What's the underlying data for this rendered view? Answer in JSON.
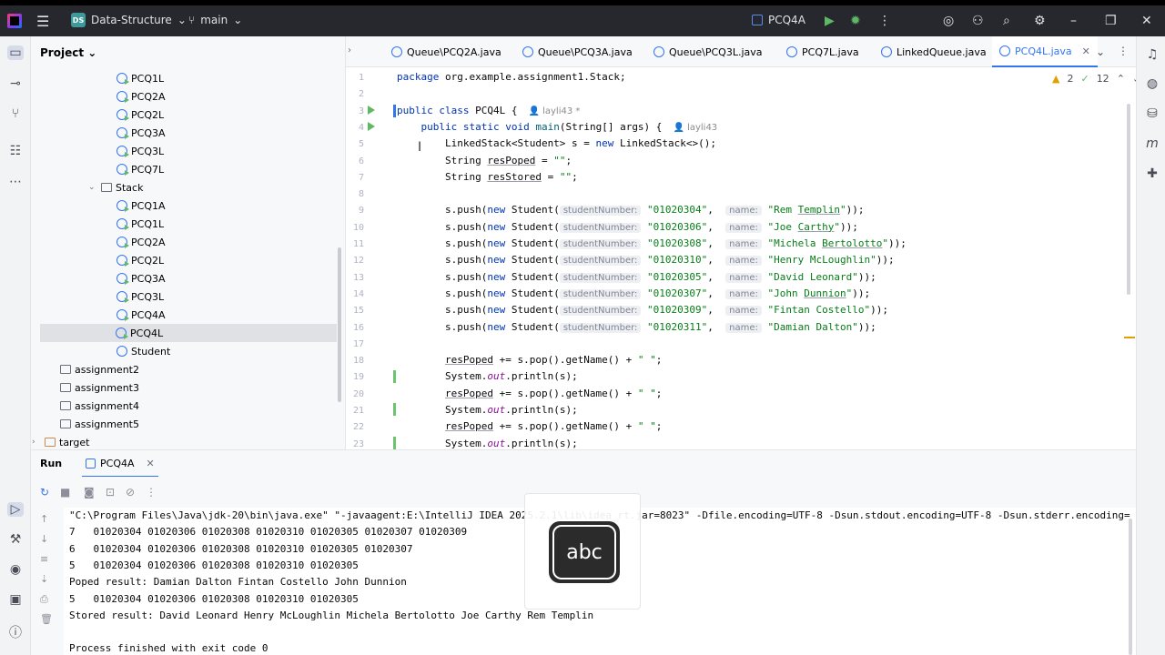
{
  "titlebar": {
    "project_badge": "DS",
    "project_name": "Data-Structure",
    "branch": "main",
    "run_config": "PCQ4A"
  },
  "project_panel": {
    "title": "Project",
    "items": [
      {
        "label": "PCQ1L",
        "type": "class-run",
        "indent": 3
      },
      {
        "label": "PCQ2A",
        "type": "class-run",
        "indent": 3
      },
      {
        "label": "PCQ2L",
        "type": "class-run",
        "indent": 3
      },
      {
        "label": "PCQ3A",
        "type": "class-run",
        "indent": 3
      },
      {
        "label": "PCQ3L",
        "type": "class-run",
        "indent": 3
      },
      {
        "label": "PCQ7L",
        "type": "class-run",
        "indent": 3
      },
      {
        "label": "Stack",
        "type": "package",
        "indent": 2
      },
      {
        "label": "PCQ1A",
        "type": "class-run",
        "indent": 3
      },
      {
        "label": "PCQ1L",
        "type": "class-run",
        "indent": 3
      },
      {
        "label": "PCQ2A",
        "type": "class-run",
        "indent": 3
      },
      {
        "label": "PCQ2L",
        "type": "class-run",
        "indent": 3
      },
      {
        "label": "PCQ3A",
        "type": "class-run",
        "indent": 3
      },
      {
        "label": "PCQ3L",
        "type": "class-run",
        "indent": 3
      },
      {
        "label": "PCQ4A",
        "type": "class-run",
        "indent": 3
      },
      {
        "label": "PCQ4L",
        "type": "class-run",
        "indent": 3,
        "selected": true
      },
      {
        "label": "Student",
        "type": "class",
        "indent": 3
      },
      {
        "label": "assignment2",
        "type": "package",
        "indent": 1
      },
      {
        "label": "assignment3",
        "type": "package",
        "indent": 1
      },
      {
        "label": "assignment4",
        "type": "package",
        "indent": 1
      },
      {
        "label": "assignment5",
        "type": "package",
        "indent": 1
      },
      {
        "label": "target",
        "type": "folder",
        "indent": 0
      }
    ]
  },
  "tabs": [
    {
      "label": "Queue\\PCQ2A.java"
    },
    {
      "label": "Queue\\PCQ3A.java"
    },
    {
      "label": "Queue\\PCQ3L.java"
    },
    {
      "label": "PCQ7L.java"
    },
    {
      "label": "LinkedQueue.java"
    },
    {
      "label": "PCQ4L.java",
      "active": true
    }
  ],
  "editor": {
    "warnings": "2",
    "checks": "12",
    "lines": [
      {
        "n": "1",
        "html": "<span class='kw'>package</span> org.example.assignment1.Stack;"
      },
      {
        "n": "2",
        "html": ""
      },
      {
        "n": "3",
        "html": "<span class='kw'>public class</span> PCQ4L {<span class='author'>👤 layli43 *</span>"
      },
      {
        "n": "4",
        "html": "    <span class='kw'>public static void</span> <span style='color:#00627a'>main</span>(String[] args) {<span class='author'>👤 layli43</span>"
      },
      {
        "n": "5",
        "html": "        LinkedStack&lt;Student&gt; s = <span class='kw'>new</span> LinkedStack&lt;&gt;();"
      },
      {
        "n": "6",
        "html": "        String <span class='underl'>resPoped</span> = <span class='str'>\"\"</span>;"
      },
      {
        "n": "7",
        "html": "        String <span class='underl'>resStored</span> = <span class='str'>\"\"</span>;"
      },
      {
        "n": "8",
        "html": ""
      },
      {
        "n": "9",
        "html": "        s.push(<span class='kw'>new</span> Student(<span class='hint'>studentNumber:</span> <span class='str'>\"01020304\"</span>,  <span class='hint'>name:</span> <span class='str'>\"Rem <span class='underl'>Templin</span>\"</span>));"
      },
      {
        "n": "10",
        "html": "        s.push(<span class='kw'>new</span> Student(<span class='hint'>studentNumber:</span> <span class='str'>\"01020306\"</span>,  <span class='hint'>name:</span> <span class='str'>\"Joe <span class='underl'>Carthy</span>\"</span>));"
      },
      {
        "n": "11",
        "html": "        s.push(<span class='kw'>new</span> Student(<span class='hint'>studentNumber:</span> <span class='str'>\"01020308\"</span>,  <span class='hint'>name:</span> <span class='str'>\"Michela <span class='underl'>Bertolotto</span>\"</span>));"
      },
      {
        "n": "12",
        "html": "        s.push(<span class='kw'>new</span> Student(<span class='hint'>studentNumber:</span> <span class='str'>\"01020310\"</span>,  <span class='hint'>name:</span> <span class='str'>\"Henry McLoughlin\"</span>));"
      },
      {
        "n": "13",
        "html": "        s.push(<span class='kw'>new</span> Student(<span class='hint'>studentNumber:</span> <span class='str'>\"01020305\"</span>,  <span class='hint'>name:</span> <span class='str'>\"David Leonard\"</span>));"
      },
      {
        "n": "14",
        "html": "        s.push(<span class='kw'>new</span> Student(<span class='hint'>studentNumber:</span> <span class='str'>\"01020307\"</span>,  <span class='hint'>name:</span> <span class='str'>\"John <span class='underl'>Dunnion</span>\"</span>));"
      },
      {
        "n": "15",
        "html": "        s.push(<span class='kw'>new</span> Student(<span class='hint'>studentNumber:</span> <span class='str'>\"01020309\"</span>,  <span class='hint'>name:</span> <span class='str'>\"Fintan Costello\"</span>));"
      },
      {
        "n": "16",
        "html": "        s.push(<span class='kw'>new</span> Student(<span class='hint'>studentNumber:</span> <span class='str'>\"01020311\"</span>,  <span class='hint'>name:</span> <span class='str'>\"Damian Dalton\"</span>));"
      },
      {
        "n": "17",
        "html": ""
      },
      {
        "n": "18",
        "html": "        <span class='underl'>resPoped</span> += s.pop().getName() + <span class='str'>\" \"</span>;"
      },
      {
        "n": "19",
        "html": "        System.<span class='ital'>out</span>.println(s);"
      },
      {
        "n": "20",
        "html": "        <span class='underl'>resPoped</span> += s.pop().getName() + <span class='str'>\" \"</span>;"
      },
      {
        "n": "21",
        "html": "        System.<span class='ital'>out</span>.println(s);"
      },
      {
        "n": "22",
        "html": "        <span class='underl'>resPoped</span> += s.pop().getName() + <span class='str'>\" \"</span>;"
      },
      {
        "n": "23",
        "html": "        System.<span class='ital'>out</span>.println(s);"
      }
    ]
  },
  "run_panel": {
    "title": "Run",
    "tab": "PCQ4A",
    "output": [
      "\"C:\\Program Files\\Java\\jdk-20\\bin\\java.exe\" \"-javaagent:E:\\IntelliJ IDEA 2025.2.1\\lib\\idea_rt.jar=8023\" -Dfile.encoding=UTF-8 -Dsun.stdout.encoding=UTF-8 -Dsun.stderr.encoding=",
      "7   01020304 01020306 01020308 01020310 01020305 01020307 01020309",
      "6   01020304 01020306 01020308 01020310 01020305 01020307",
      "5   01020304 01020306 01020308 01020310 01020305",
      "Poped result: Damian Dalton Fintan Costello John Dunnion",
      "5   01020304 01020306 01020308 01020310 01020305",
      "Stored result: David Leonard Henry McLoughlin Michela Bertolotto Joe Carthy Rem Templin",
      "",
      "Process finished with exit code 0"
    ]
  },
  "overlay": {
    "label": "abc"
  }
}
